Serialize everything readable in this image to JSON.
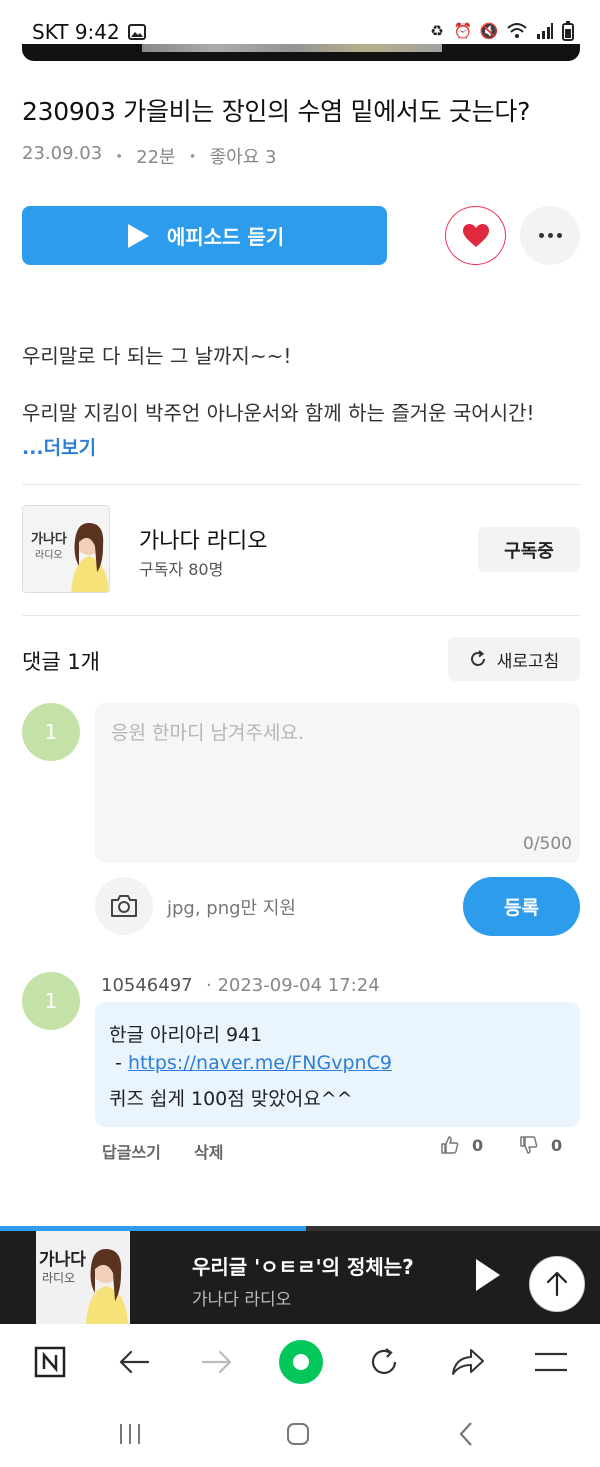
{
  "status": {
    "carrier_time": "SKT 9:42"
  },
  "episode": {
    "title": "230903 가을비는 장인의 수염 밑에서도 긋는다?",
    "date": "23.09.03",
    "duration": "22분",
    "likes": "좋아요 3",
    "separator": "・"
  },
  "actions": {
    "play_label": "에피소드 듣기"
  },
  "description": {
    "line1": "우리말로 다 되는 그 날까지~~!",
    "line2": "우리말 지킴이 박주언 아나운서와 함께 하는 즐거운 국어시간!",
    "more_label": "...더보기"
  },
  "channel": {
    "name": "가나다 라디오",
    "subscribers": "구독자 80명",
    "subscribe_label": "구독중",
    "thumb_text": {
      "line1": "가나다",
      "line2": "라디오"
    }
  },
  "comments": {
    "header": "댓글 1개",
    "refresh_label": "새로고침",
    "my_avatar_text": "1",
    "input_placeholder": "응원 한마디 남겨주세요.",
    "char_count": "0/500",
    "attach_hint": "jpg, png만 지원",
    "submit_label": "등록",
    "items": [
      {
        "avatar_text": "1",
        "user": "10546497",
        "date": "· 2023-09-04 17:24",
        "line1": "한글 아리아리 941",
        "line2_prefix": " - ",
        "line2_link": "https://naver.me/FNGvpnC9",
        "line3": "퀴즈 쉽게 100점 맞았어요^^",
        "reply_label": "답글쓰기",
        "delete_label": "삭제",
        "upvotes": "0",
        "downvotes": "0"
      }
    ]
  },
  "player": {
    "title": "우리글 'ㅇㅌㄹ'의 정체는?",
    "channel": "가나다 라디오",
    "progress": 0.51
  },
  "icons": {
    "status_icons": [
      "gallery-icon",
      "recycle-icon",
      "alarm-icon",
      "mute-icon",
      "wifi-icon",
      "signal-icon",
      "battery-icon"
    ],
    "browser": [
      "naver-home-icon",
      "back-arrow-icon",
      "forward-arrow-icon",
      "green-dot-icon",
      "reload-icon",
      "share-icon",
      "menu-icon"
    ]
  },
  "colors": {
    "accent": "#2d9cec",
    "like": "#e0293f",
    "avatar": "#c4e2a8",
    "bubble": "#e9f4fd",
    "naver_green": "#03c75a"
  }
}
